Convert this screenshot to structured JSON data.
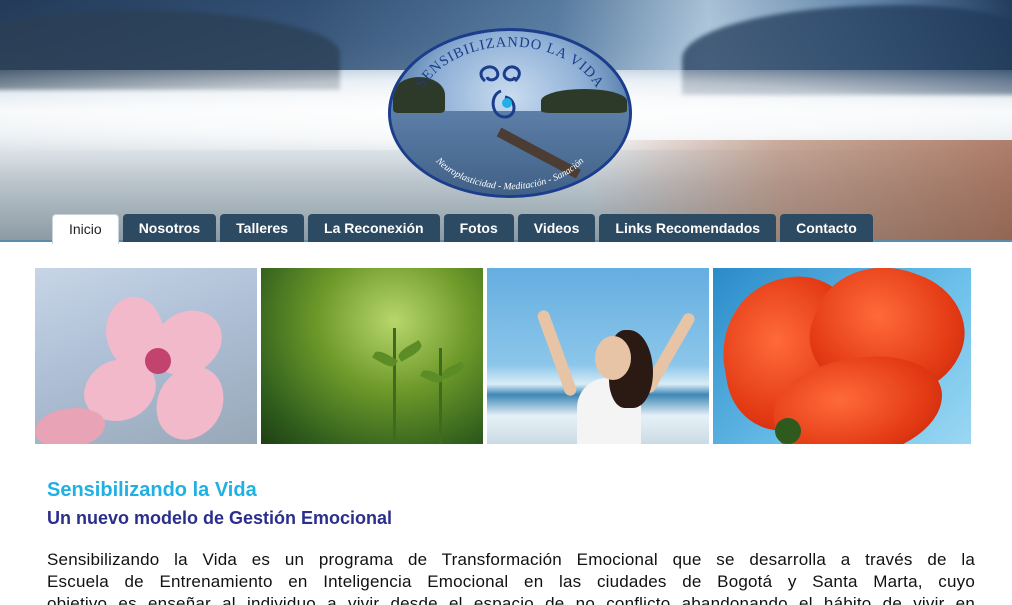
{
  "logo": {
    "arc_top": "SENSIBILIZANDO LA VIDA",
    "arc_bottom": "Neuroplasticidad - Meditación - Sanación"
  },
  "nav": {
    "tabs": [
      {
        "label": "Inicio",
        "active": true
      },
      {
        "label": "Nosotros"
      },
      {
        "label": "Talleres"
      },
      {
        "label": "La Reconexión"
      },
      {
        "label": "Fotos"
      },
      {
        "label": "Videos"
      },
      {
        "label": "Links Recomendados"
      },
      {
        "label": "Contacto"
      }
    ]
  },
  "main": {
    "title": "Sensibilizando la Vida",
    "subtitle": "Un nuevo modelo de Gestión Emocional",
    "body_lines": [
      "Sensibilizando la Vida es un programa de Transformación Emocional que se desarrolla a través de la",
      "Escuela de Entrenamiento en Inteligencia Emocional en las ciudades de Bogotá y Santa Marta, cuyo",
      "objetivo es enseñar al individuo a vivir desde el espacio de no conflicto abandonando el hábito de vivir en"
    ]
  },
  "colors": {
    "nav_tab": "#2d4a63",
    "title": "#1fb0e4",
    "subtitle": "#2b2f8c",
    "logo_border": "#1b3d8c"
  }
}
